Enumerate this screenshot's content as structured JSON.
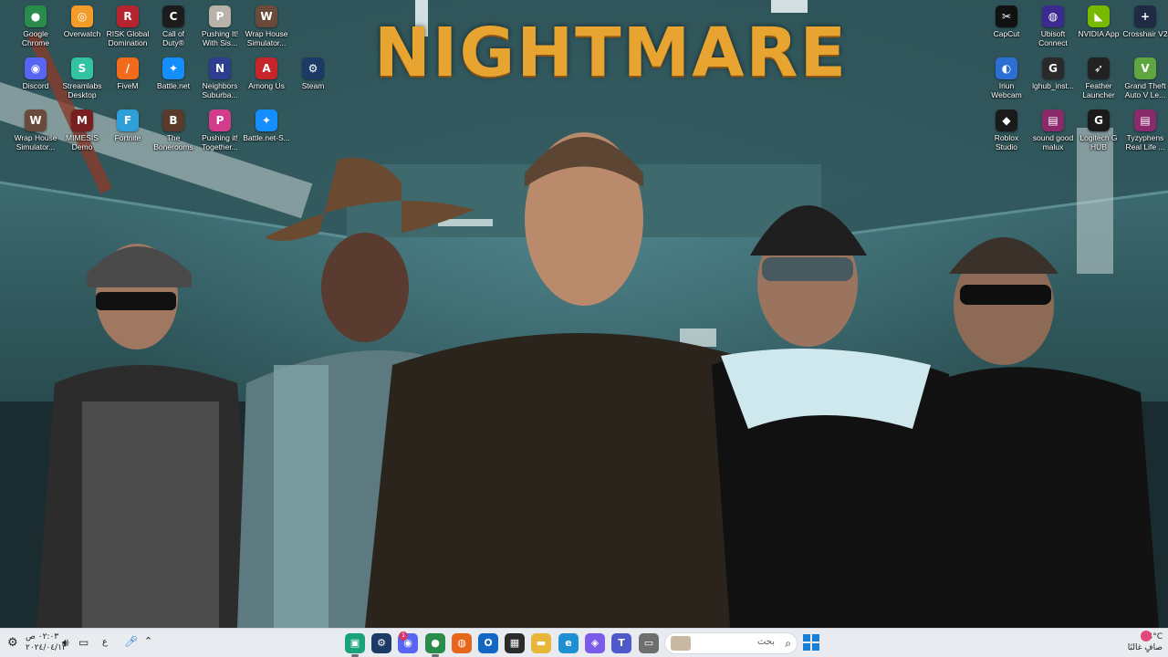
{
  "wallpaper": {
    "title": "NIGHTMARE"
  },
  "desktop_icons_left": [
    {
      "label": "Google\nChrome",
      "icon": "chrome-icon",
      "color": "#2a8c4a",
      "glyph": "●"
    },
    {
      "label": "Overwatch",
      "icon": "overwatch-icon",
      "color": "#f39c2a",
      "glyph": "◎"
    },
    {
      "label": "RISK Global\nDomination",
      "icon": "risk-icon",
      "color": "#b5242f",
      "glyph": "R"
    },
    {
      "label": "Call of\nDuty®",
      "icon": "call-of-duty-icon",
      "color": "#1c1c1c",
      "glyph": "C"
    },
    {
      "label": "Pushing It!\nWith Sis...",
      "icon": "pushing-it-icon",
      "color": "#b8b2a8",
      "glyph": "P"
    },
    {
      "label": "Wrap House\nSimulator...",
      "icon": "wrap-house-icon",
      "color": "#6a4a3a",
      "glyph": "W"
    },
    {
      "label": "Discord",
      "icon": "discord-icon",
      "color": "#5865f2",
      "glyph": "◉"
    },
    {
      "label": "Streamlabs\nDesktop",
      "icon": "streamlabs-icon",
      "color": "#31c3a2",
      "glyph": "S"
    },
    {
      "label": "FiveM",
      "icon": "fivem-icon",
      "color": "#f26a1b",
      "glyph": "/"
    },
    {
      "label": "Battle.net",
      "icon": "battlenet-icon",
      "color": "#148eff",
      "glyph": "✦"
    },
    {
      "label": "Neighbors\nSuburba...",
      "icon": "neighbors-icon",
      "color": "#2c3e8f",
      "glyph": "N"
    },
    {
      "label": "Among Us",
      "icon": "among-us-icon",
      "color": "#c8252b",
      "glyph": "A"
    },
    {
      "label": "Steam",
      "icon": "steam-icon",
      "color": "#1b3b66",
      "glyph": "⚙"
    },
    {
      "label": "Wrap House\nSimulator...",
      "icon": "wrap-house-icon",
      "color": "#6a4a3a",
      "glyph": "W"
    },
    {
      "label": "MIMESIS\nDemo",
      "icon": "mimesis-icon",
      "color": "#7a1f1f",
      "glyph": "M"
    },
    {
      "label": "Fortnite",
      "icon": "fortnite-icon",
      "color": "#2f9ed9",
      "glyph": "F"
    },
    {
      "label": "The\nBonerooms",
      "icon": "bonerooms-icon",
      "color": "#5a3a2a",
      "glyph": "B"
    },
    {
      "label": "Pushing it!\nTogether...",
      "icon": "pushing-together-icon",
      "color": "#d23c8a",
      "glyph": "P"
    },
    {
      "label": "Battle.net-S...",
      "icon": "battlenet-setup-icon",
      "color": "#148eff",
      "glyph": "✦"
    }
  ],
  "desktop_icons_right": [
    {
      "label": "CapCut",
      "icon": "capcut-icon",
      "color": "#111111",
      "glyph": "✂"
    },
    {
      "label": "Ubisoft\nConnect",
      "icon": "ubisoft-icon",
      "color": "#3b2a8f",
      "glyph": "◍"
    },
    {
      "label": "NVIDIA App",
      "icon": "nvidia-icon",
      "color": "#76b900",
      "glyph": "◣"
    },
    {
      "label": "Crosshair V2",
      "icon": "crosshair-icon",
      "color": "#1f2a44",
      "glyph": "+"
    },
    {
      "label": "Iriun\nWebcam",
      "icon": "iriun-icon",
      "color": "#2b6fd4",
      "glyph": "◐"
    },
    {
      "label": "lghub_inst...",
      "icon": "lghub-installer-icon",
      "color": "#2a2a2a",
      "glyph": "G"
    },
    {
      "label": "Feather\nLauncher",
      "icon": "feather-icon",
      "color": "#222222",
      "glyph": "➶"
    },
    {
      "label": "Grand Theft\nAuto V Le...",
      "icon": "gta-v-icon",
      "color": "#5fa640",
      "glyph": "V"
    },
    {
      "label": "Roblox\nStudio",
      "icon": "roblox-studio-icon",
      "color": "#1a1a1a",
      "glyph": "◆"
    },
    {
      "label": "sound good\nmalux",
      "icon": "winrar-icon",
      "color": "#8a2a6a",
      "glyph": "▤"
    },
    {
      "label": "Logitech G\nHUB",
      "icon": "logitech-ghub-icon",
      "color": "#1a1a1a",
      "glyph": "G"
    },
    {
      "label": "Tyzyphens\nReal Life ...",
      "icon": "winrar-icon",
      "color": "#8a2a6a",
      "glyph": "▤"
    }
  ],
  "taskbar": {
    "clock_time": "٠٢:٠٣ ص",
    "clock_date": "٢٠٢٤/٠٤/١٣",
    "search_placeholder": "بحث",
    "language": "ع",
    "weather_temp": "24°C",
    "weather_desc": "صافٍ غالبًا",
    "discord_badge": "1",
    "apps": [
      {
        "name": "taskbar-app-clipchamp",
        "color": "#1aa37a",
        "glyph": "▣"
      },
      {
        "name": "taskbar-app-steam",
        "color": "#1b3b66",
        "glyph": "⚙"
      },
      {
        "name": "taskbar-app-discord",
        "color": "#5865f2",
        "glyph": "◉"
      },
      {
        "name": "taskbar-app-chrome",
        "color": "#2a8c4a",
        "glyph": "●"
      },
      {
        "name": "taskbar-app-firefox",
        "color": "#e8651c",
        "glyph": "◍"
      },
      {
        "name": "taskbar-app-outlook",
        "color": "#1267c4",
        "glyph": "O"
      },
      {
        "name": "taskbar-app-store",
        "color": "#2b2b2b",
        "glyph": "▦"
      },
      {
        "name": "taskbar-app-file-explorer",
        "color": "#e8b73a",
        "glyph": "▬"
      },
      {
        "name": "taskbar-app-edge",
        "color": "#1f8fd1",
        "glyph": "e"
      },
      {
        "name": "taskbar-app-copilot",
        "color": "#7a5ae8",
        "glyph": "◈"
      },
      {
        "name": "taskbar-app-teams",
        "color": "#5059c9",
        "glyph": "T"
      },
      {
        "name": "taskbar-app-window",
        "color": "#6e6e6e",
        "glyph": "▭"
      }
    ]
  }
}
